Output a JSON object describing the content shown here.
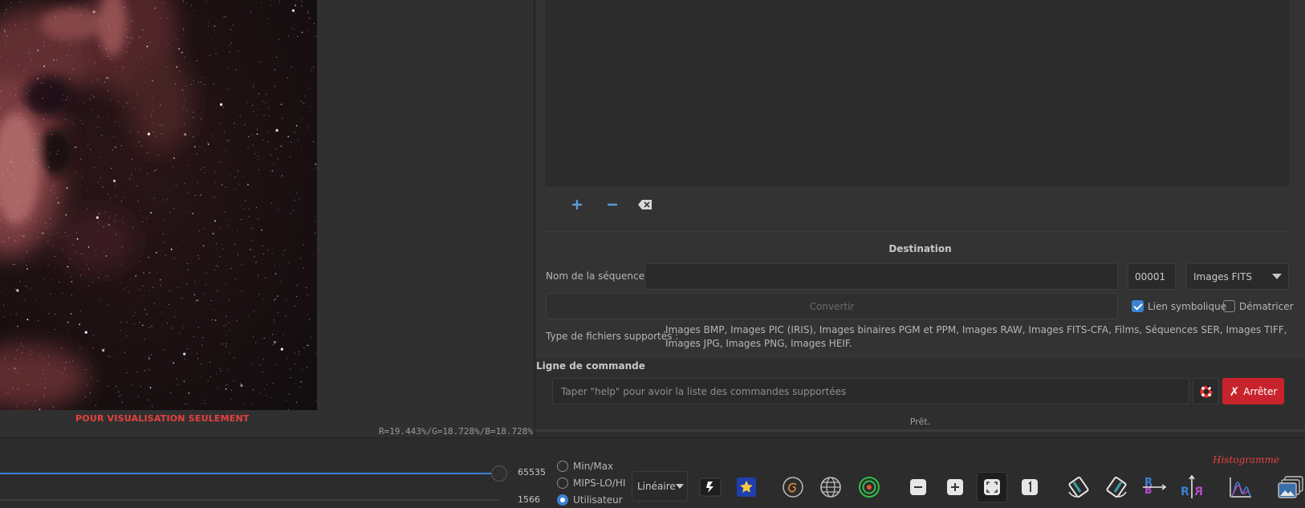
{
  "viewer": {
    "caption": "POUR VISUALISATION SEULEMENT",
    "rgb_readout": "R=19.443%/G=18.728%/B=18.728%"
  },
  "file_list": {
    "add_icon": "plus-icon",
    "remove_icon": "minus-icon",
    "clear_icon": "backspace-icon"
  },
  "destination": {
    "title": "Destination",
    "sequence_label": "Nom de la séquence :",
    "sequence_value": "",
    "index_value": "00001",
    "format_value": "Images FITS",
    "convert_label": "Convertir",
    "symlink_label": "Lien symbolique",
    "symlink_checked": true,
    "debayer_label": "Dématricer",
    "debayer_checked": false,
    "types_label": "Type de fichiers supportés :",
    "types_text": "Images BMP, Images PIC (IRIS), Images binaires PGM et PPM, Images RAW, Images FITS-CFA, Films, Séquences SER, Images TIFF, Images JPG, Images PNG, Images HEIF."
  },
  "command": {
    "title": "Ligne de commande",
    "placeholder": "Taper \"help\" pour avoir la liste des commandes supportées",
    "stop_label": "Arrêter",
    "status": "Prêt."
  },
  "display": {
    "hi_value": "65535",
    "lo_value": "1566",
    "radio_minmax": "Min/Max",
    "radio_mips": "MIPS-LO/HI",
    "radio_user": "Utilisateur",
    "selected_mode": "Utilisateur",
    "scale_value": "Linéaire",
    "histogram_tooltip": "Histogramme"
  },
  "colors": {
    "accent": "#3a82d6",
    "stop": "#c8232c",
    "caption": "#e84040"
  }
}
